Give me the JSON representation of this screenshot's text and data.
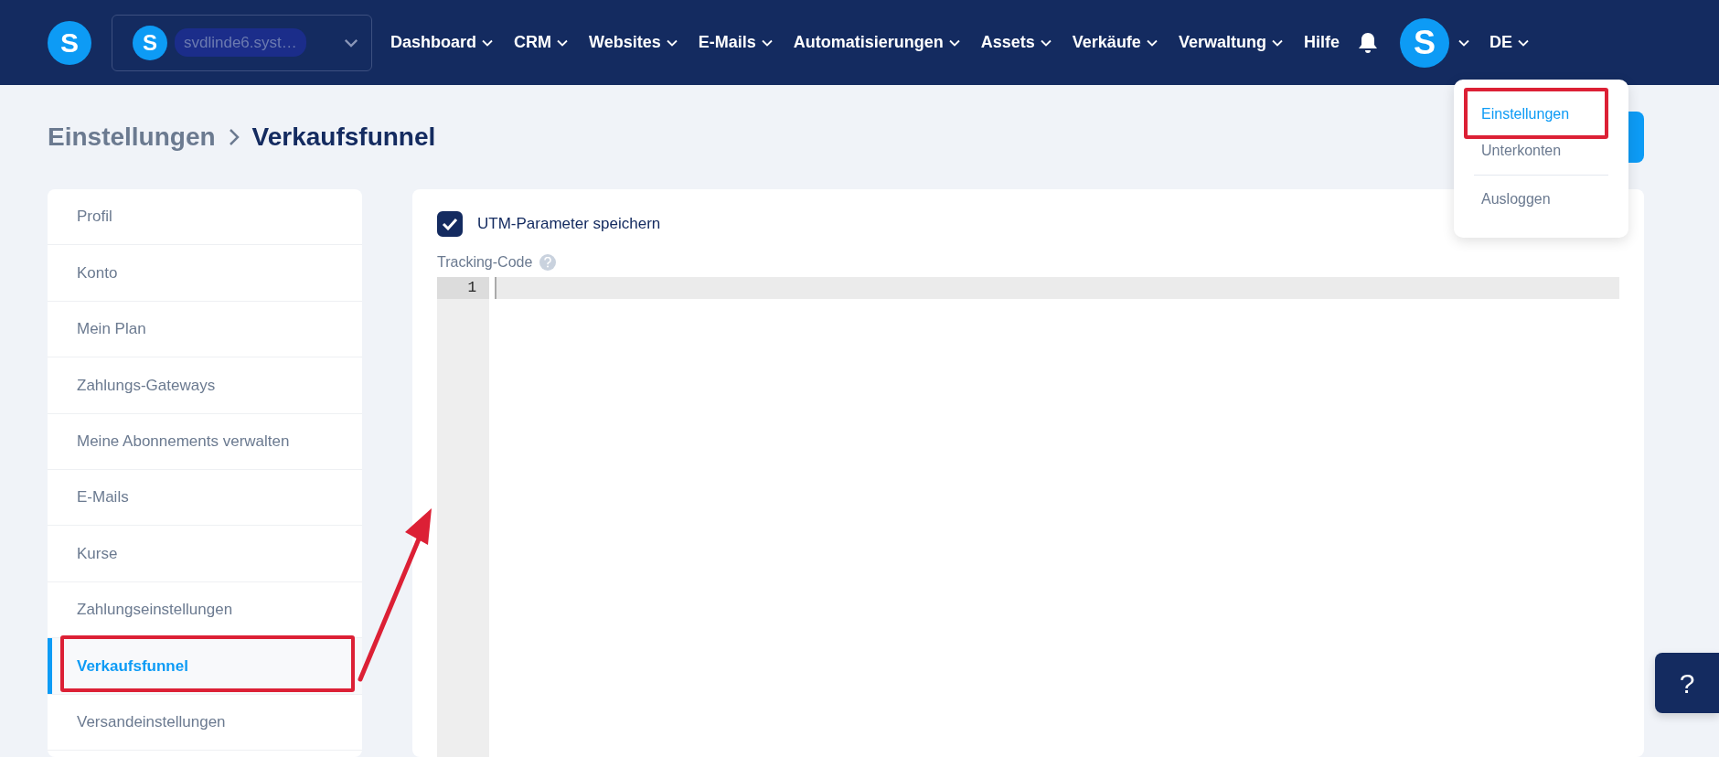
{
  "navbar": {
    "logo": {
      "letter": "S"
    },
    "account": {
      "logo_letter": "S",
      "name": "svdlinde6.syst…"
    },
    "menu": [
      {
        "label": "Dashboard",
        "dropdown": true
      },
      {
        "label": "CRM",
        "dropdown": true
      },
      {
        "label": "Websites",
        "dropdown": true
      },
      {
        "label": "E-Mails",
        "dropdown": true
      },
      {
        "label": "Automatisierungen",
        "dropdown": true
      },
      {
        "label": "Assets",
        "dropdown": true
      },
      {
        "label": "Verkäufe",
        "dropdown": true
      },
      {
        "label": "Verwaltung",
        "dropdown": true
      },
      {
        "label": "Hilfe",
        "dropdown": false
      }
    ],
    "avatar": {
      "letter": "S"
    },
    "language": "DE"
  },
  "user_menu": {
    "groups": [
      [
        {
          "label": "Einstellungen",
          "selected": true
        },
        {
          "label": "Unterkonten",
          "selected": false
        }
      ],
      [
        {
          "label": "Ausloggen",
          "selected": false
        }
      ]
    ]
  },
  "breadcrumb": [
    "Einstellungen",
    "Verkaufsfunnel"
  ],
  "sidebar": {
    "items": [
      {
        "label": "Profil",
        "selected": false
      },
      {
        "label": "Konto",
        "selected": false
      },
      {
        "label": "Mein Plan",
        "selected": false
      },
      {
        "label": "Zahlungs-Gateways",
        "selected": false
      },
      {
        "label": "Meine Abonnements verwalten",
        "selected": false
      },
      {
        "label": "E-Mails",
        "selected": false
      },
      {
        "label": "Kurse",
        "selected": false
      },
      {
        "label": "Zahlungseinstellungen",
        "selected": false
      },
      {
        "label": "Verkaufsfunnel",
        "selected": true
      },
      {
        "label": "Versandeinstellungen",
        "selected": false
      }
    ]
  },
  "settings": {
    "utm": {
      "label": "UTM-Parameter speichern",
      "checked": true
    },
    "tracking_code": {
      "label": "Tracking-Code",
      "line_numbers": [
        "1"
      ]
    }
  },
  "help_button": {
    "label": "?"
  }
}
